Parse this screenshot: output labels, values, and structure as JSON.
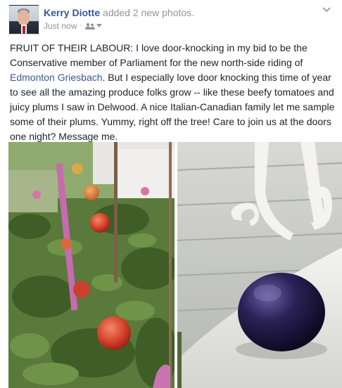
{
  "post": {
    "author": "Kerry Diotte",
    "action": "added 2 new photos.",
    "timestamp": "Just now",
    "privacy_icon": "friends-icon",
    "text_before_link": "FRUIT OF THEIR LABOUR: I love door-knocking in my bid to be the Conservative member of Parliament for the new north-side riding of ",
    "link_text": "Edmonton Griesbach",
    "text_after_link": ". But I especially love door knocking this time of year to see all the amazing produce folks grow -- like these beefy tomatoes and juicy plums I saw in Delwood. A nice Italian-Canadian family let me sample some of their plums. Yummy, right off the tree! Care to join us at the doors one night? Message me."
  },
  "colors": {
    "author": "#365899",
    "meta": "#90949c",
    "text": "#1d2129",
    "link": "#365899"
  }
}
